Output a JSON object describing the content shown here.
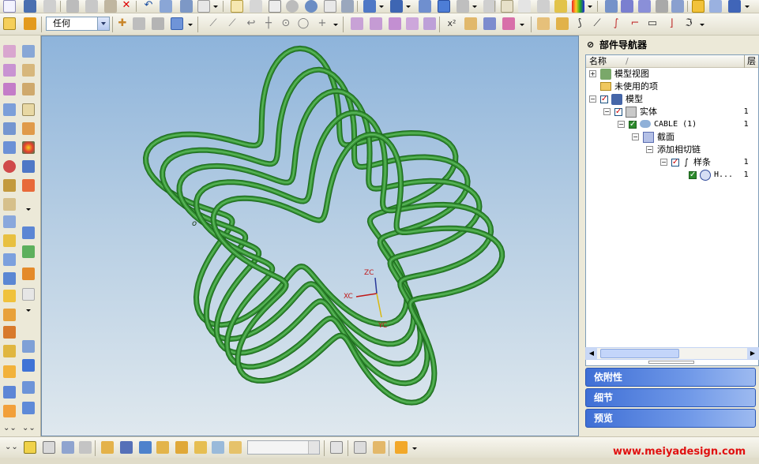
{
  "toolbar": {
    "filter_value": "任何"
  },
  "navigator": {
    "title": "部件导航器",
    "columns": {
      "name": "名称",
      "layer": "层"
    },
    "tree": [
      {
        "label": "模型视图",
        "layer": ""
      },
      {
        "label": "未使用的项",
        "layer": ""
      },
      {
        "label": "模型",
        "layer": ""
      },
      {
        "label": "实体",
        "layer": "1"
      },
      {
        "label": "CABLE (1)",
        "layer": "1"
      },
      {
        "label": "截面",
        "layer": ""
      },
      {
        "label": "添加相切链",
        "layer": ""
      },
      {
        "label": "样条",
        "layer": "1"
      },
      {
        "label": "H...",
        "layer": "1"
      }
    ],
    "panels": {
      "dependencies": "依附性",
      "details": "细节",
      "preview": "预览"
    }
  },
  "viewport": {
    "triad": {
      "zc": "ZC",
      "xc": "XC",
      "yc": "YC"
    },
    "accent_color": "#3a9a3a"
  },
  "watermark": "www.meiyadesign.com"
}
